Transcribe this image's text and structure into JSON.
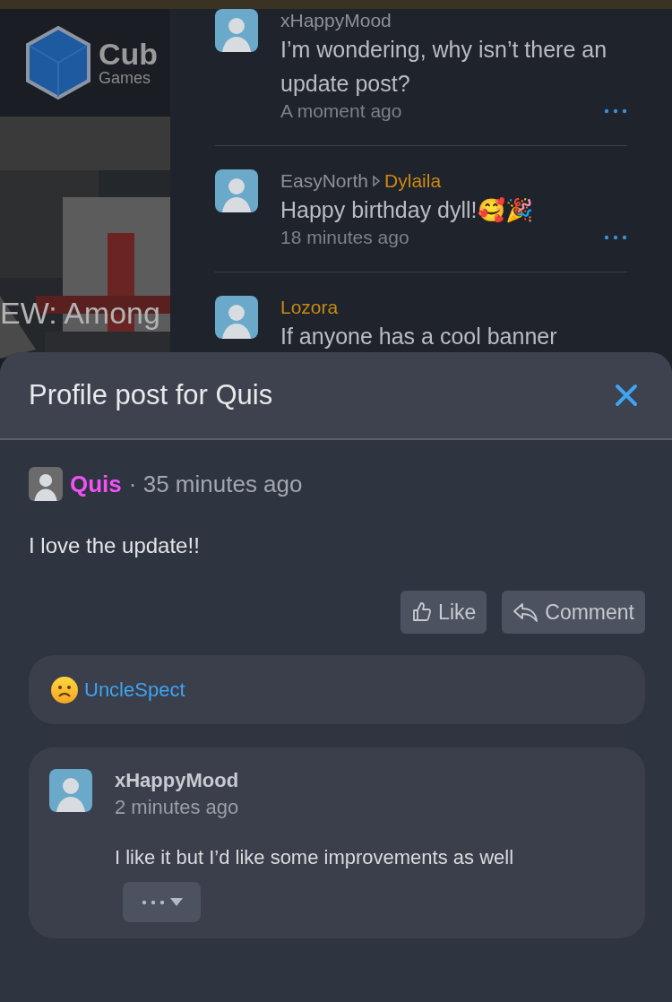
{
  "sidebar": {
    "logo": {
      "name": "Cub",
      "tagline": "Games"
    },
    "banner": {
      "kind": "picture",
      "headline": "EW: Among"
    }
  },
  "feed": [
    {
      "author": {
        "name": "xHappyMood",
        "color": "#8d9099"
      },
      "message": "I’m wondering, why isn’t there an update post?",
      "time": "A moment ago"
    },
    {
      "author": {
        "name": "EasyNorth",
        "color": "#8d9099"
      },
      "recipient": {
        "name": "Dylaila",
        "color": "#c98a12"
      },
      "message": "Happy birthday dyll!🥰🎉",
      "time": "18 minutes ago"
    },
    {
      "author": {
        "name": "Lozora",
        "color": "#c98a12"
      },
      "message": "If anyone has a cool banner"
    }
  ],
  "modal": {
    "title": "Profile post for Quis",
    "post": {
      "author": {
        "name": "Quis",
        "color": "#f152f5"
      },
      "separator": "·",
      "time": "35 minutes ago",
      "body": "I love the update!!",
      "actions": [
        {
          "kind": "like",
          "label": "Like"
        },
        {
          "kind": "comment",
          "label": "Comment"
        }
      ]
    },
    "reactions": [
      {
        "user": "UncleSpect"
      }
    ],
    "comments": [
      {
        "author": "xHappyMood",
        "time": "2 minutes ago",
        "body": "I like it but I’d like some improvements as well"
      }
    ]
  }
}
